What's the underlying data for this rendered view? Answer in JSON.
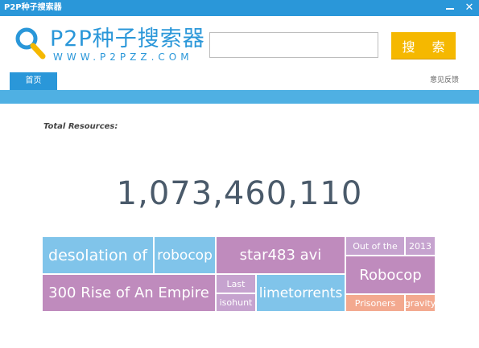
{
  "window": {
    "title": "P2P种子搜索器"
  },
  "header": {
    "logo_title": "P2P种子搜索器",
    "logo_url_text": "WWW.P2PZZ.COM",
    "search_value": "",
    "search_button_label": "搜 索"
  },
  "nav": {
    "home_tab": "首页",
    "feedback_link": "意见反馈"
  },
  "stats": {
    "total_label": "Total Resources:",
    "total_value": "1,073,460,110"
  },
  "colors": {
    "brand_blue": "#2a97d9",
    "nav_bar": "#4fb0e3",
    "search_button": "#f5b800",
    "tile_blue": "#80c4ea",
    "tile_purple": "#bf8bbd",
    "tile_lavender": "#c6a3cf",
    "tile_salmon": "#f3a98f"
  },
  "tags": [
    {
      "label": "desolation of",
      "color": "#80c4ea"
    },
    {
      "label": "robocop",
      "color": "#80c4ea"
    },
    {
      "label": "star483 avi",
      "color": "#bf8bbd"
    },
    {
      "label": "Out of the",
      "color": "#c6a3cf"
    },
    {
      "label": "2013",
      "color": "#c6a3cf"
    },
    {
      "label": "Robocop",
      "color": "#bf8bbd"
    },
    {
      "label": "300 Rise of An Empire",
      "color": "#bf8bbd"
    },
    {
      "label": "Last",
      "color": "#c6a3cf"
    },
    {
      "label": "isohunt",
      "color": "#c6a3cf"
    },
    {
      "label": "limetorrents",
      "color": "#80c4ea"
    },
    {
      "label": "Prisoners",
      "color": "#f3a98f"
    },
    {
      "label": "gravity",
      "color": "#f3a98f"
    }
  ]
}
